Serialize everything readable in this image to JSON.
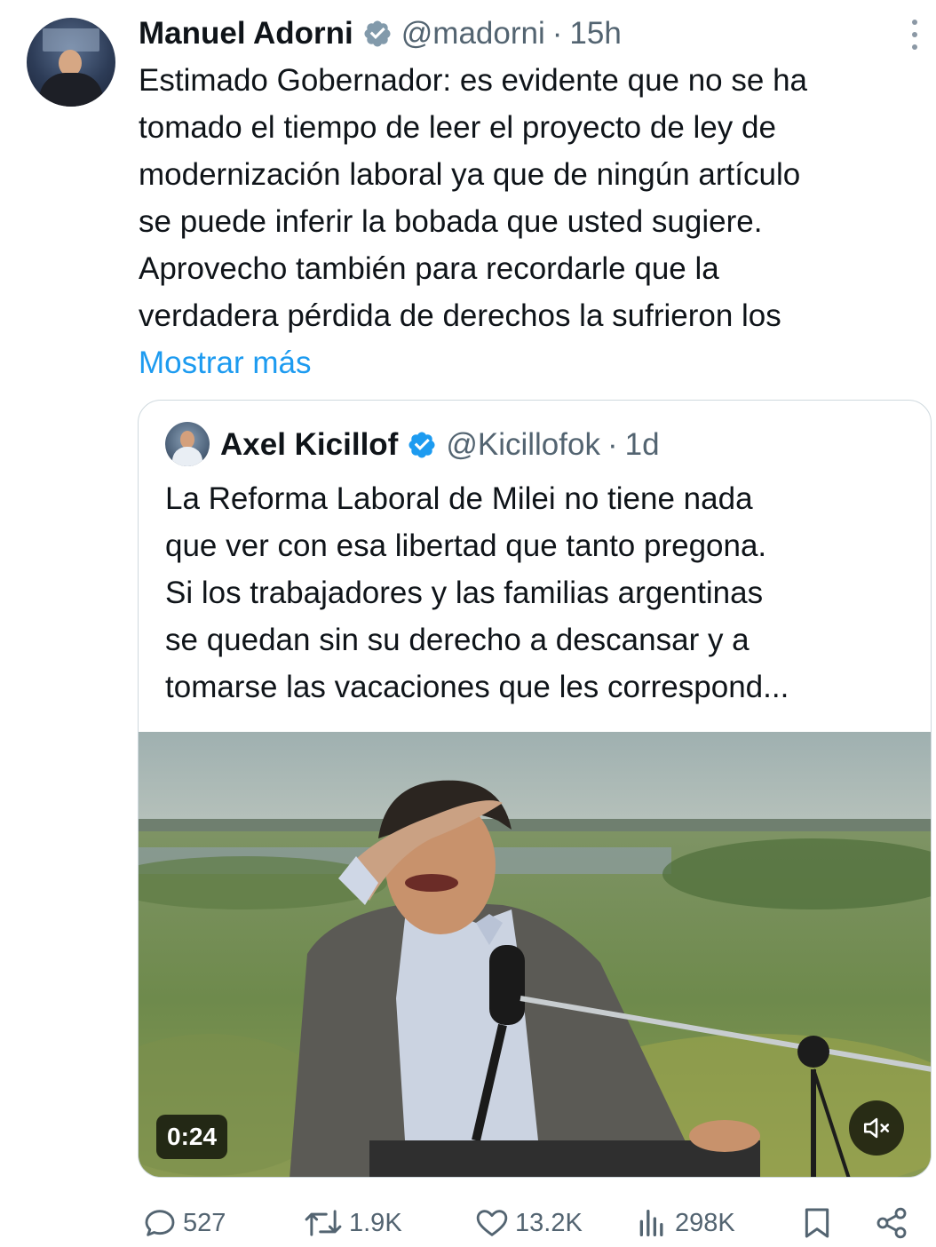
{
  "tweet": {
    "author_name": "Manuel Adorni",
    "handle": "@madorni",
    "separator": "·",
    "time": "15h",
    "text_lines": [
      "Estimado Gobernador: es evidente que no se ha",
      "tomado el tiempo de leer el proyecto de ley de",
      "modernización laboral ya que de ningún artículo",
      "se puede inferir la bobada que usted sugiere.",
      "Aprovecho también para recordarle que la",
      "verdadera pérdida de derechos la sufrieron los"
    ],
    "show_more": "Mostrar más",
    "avatar_icon": "profile-photo",
    "verified_color": "#829aab"
  },
  "quoted": {
    "author_name": "Axel Kicillof",
    "handle": "@Kicillofok",
    "separator": "·",
    "time": "1d",
    "verified_color": "#1d9bf0",
    "text_lines": [
      "La Reforma Laboral de Milei no tiene nada",
      "que ver con esa libertad que tanto pregona.",
      "Si los trabajadores y las familias argentinas",
      "se quedan sin su derecho a descansar y a",
      "tomarse las vacaciones que les correspond..."
    ],
    "video_duration": "0:24",
    "mute_icon": "speaker-muted-icon"
  },
  "actions": {
    "replies": "527",
    "retweets": "1.9K",
    "likes": "13.2K",
    "views": "298K"
  }
}
